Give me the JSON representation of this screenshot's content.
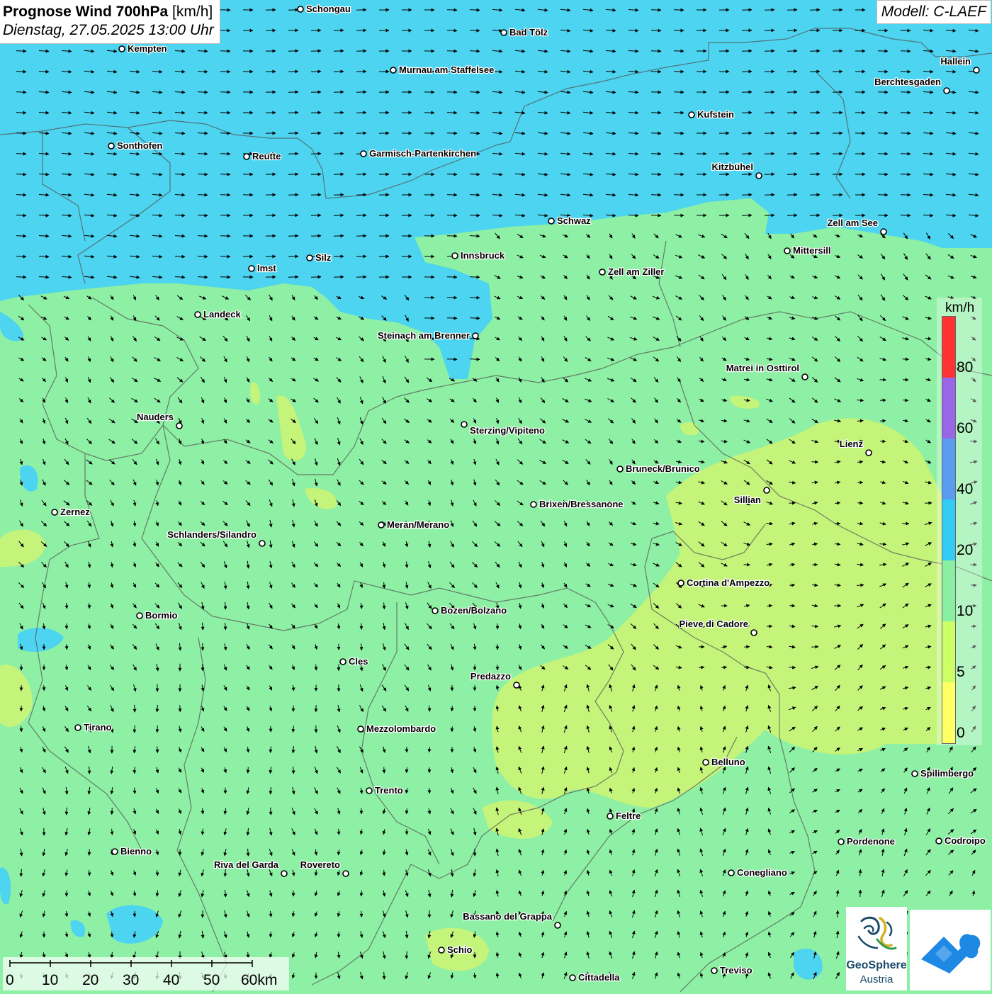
{
  "header": {
    "title_bold": "Prognose Wind 700hPa",
    "title_unit": "[km/h]",
    "date": "Dienstag, 27.05.2025 13:00 Uhr",
    "model": "Modell: C-LAEF"
  },
  "legend": {
    "unit": "km/h",
    "ticks": [
      "80",
      "60",
      "40",
      "20",
      "10",
      "5",
      "0"
    ],
    "colors": {
      "0-5": "#ffff66",
      "5-10": "#ccff66",
      "10-20": "#88f0a0",
      "20-40": "#33ccf4",
      "40-60": "#5a9cf0",
      "60-80": "#9966e8",
      "80+": "#ff3333"
    }
  },
  "scalebar": {
    "labels": [
      "0",
      "10",
      "20",
      "30",
      "40",
      "50",
      "60km"
    ]
  },
  "logos": {
    "geosphere_line1": "GeoSphere",
    "geosphere_line2": "Austria",
    "geosphere_icon": "geosphere-swirl-icon",
    "second_icon": "weather-cloud-icon"
  },
  "cities": [
    {
      "name": "Schongau"
    },
    {
      "name": "Bad Tölz"
    },
    {
      "name": "Kempten"
    },
    {
      "name": "Murnau am Staffelsee"
    },
    {
      "name": "Hallein"
    },
    {
      "name": "Berchtesgaden"
    },
    {
      "name": "Kufstein"
    },
    {
      "name": "Sonthofen"
    },
    {
      "name": "Reutte"
    },
    {
      "name": "Garmisch-Partenkirchen"
    },
    {
      "name": "Kitzbühel"
    },
    {
      "name": "Schwaz"
    },
    {
      "name": "Zell am See"
    },
    {
      "name": "Innsbruck"
    },
    {
      "name": "Mittersill"
    },
    {
      "name": "Silz"
    },
    {
      "name": "Imst"
    },
    {
      "name": "Zell am Ziller"
    },
    {
      "name": "Landeck"
    },
    {
      "name": "Steinach am Brenner"
    },
    {
      "name": "Matrei in Osttirol"
    },
    {
      "name": "Nauders"
    },
    {
      "name": "Sterzing/Vipiteno"
    },
    {
      "name": "Lienz"
    },
    {
      "name": "Bruneck/Brunico"
    },
    {
      "name": "Sillian"
    },
    {
      "name": "Zernez"
    },
    {
      "name": "Brixen/Bressanone"
    },
    {
      "name": "Meran/Merano"
    },
    {
      "name": "Schlanders/Silandro"
    },
    {
      "name": "Cortina d'Ampezzo"
    },
    {
      "name": "Bozen/Bolzano"
    },
    {
      "name": "Bormio"
    },
    {
      "name": "Pieve di Cadore"
    },
    {
      "name": "Cles"
    },
    {
      "name": "Predazzo"
    },
    {
      "name": "Tirano"
    },
    {
      "name": "Mezzolombardo"
    },
    {
      "name": "Belluno"
    },
    {
      "name": "Spilimbergo"
    },
    {
      "name": "Trento"
    },
    {
      "name": "Feltre"
    },
    {
      "name": "Pordenone"
    },
    {
      "name": "Codroipo"
    },
    {
      "name": "Bienno"
    },
    {
      "name": "Riva del Garda"
    },
    {
      "name": "Rovereto"
    },
    {
      "name": "Conegliano"
    },
    {
      "name": "Bassano del Grappa"
    },
    {
      "name": "Schio"
    },
    {
      "name": "Treviso"
    },
    {
      "name": "Cittadella"
    }
  ]
}
